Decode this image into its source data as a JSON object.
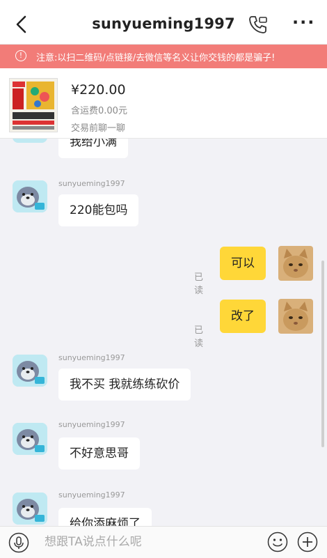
{
  "header": {
    "title": "sunyueming1997"
  },
  "warning": {
    "icon_glyph": "!",
    "text": "注意:以扫二维码/点链接/去微信等名义让你交钱的都是骗子!"
  },
  "product": {
    "price": "¥220.00",
    "shipping": "含运费0.00元",
    "chat_first": "交易前聊一聊"
  },
  "messages": [
    {
      "side": "left",
      "sender": "",
      "text": "我给小满",
      "partial": true
    },
    {
      "side": "left",
      "sender": "sunyueming1997",
      "text": "220能包吗"
    },
    {
      "side": "right",
      "read_status": "已读",
      "text": "可以"
    },
    {
      "side": "right",
      "read_status": "已读",
      "text": "改了"
    },
    {
      "side": "left",
      "sender": "sunyueming1997",
      "text": "我不买 我就练练砍价"
    },
    {
      "side": "left",
      "sender": "sunyueming1997",
      "text": "不好意思哥"
    },
    {
      "side": "left",
      "sender": "sunyueming1997",
      "text": "给你添麻烦了",
      "partial": true
    }
  ],
  "input": {
    "placeholder": "想跟TA说点什么呢"
  },
  "colors": {
    "warning_bg": "#f27c78",
    "my_bubble": "#ffd738",
    "their_bubble": "#ffffff"
  },
  "icons": [
    "back-icon",
    "phone-icon",
    "more-icon",
    "warning-icon",
    "mic-icon",
    "emoji-icon",
    "plus-icon"
  ]
}
